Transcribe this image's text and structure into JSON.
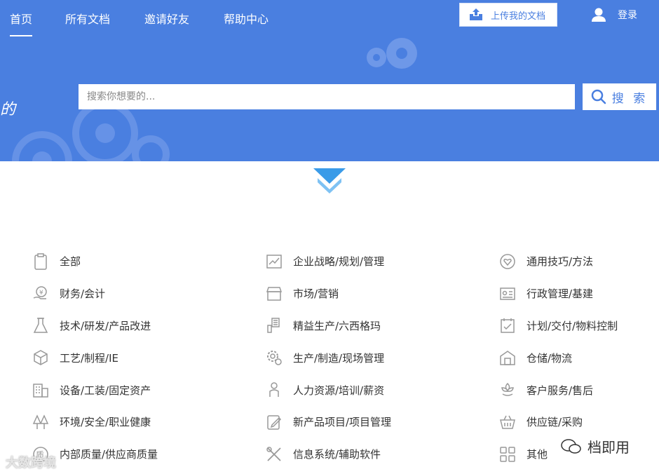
{
  "nav": {
    "items": [
      {
        "label": "首页",
        "active": true
      },
      {
        "label": "所有文档"
      },
      {
        "label": "邀请好友"
      },
      {
        "label": "帮助中心"
      }
    ],
    "upload_label": "上传我的文档",
    "login_label": "登录"
  },
  "search": {
    "placeholder": "搜索你想要的...",
    "button_label": "搜 索"
  },
  "categories": {
    "col1": [
      "全部",
      "财务/会计",
      "技术/研发/产品改进",
      "工艺/制程/IE",
      "设备/工装/固定资产",
      "环境/安全/职业健康",
      "内部质量/供应商质量"
    ],
    "col2": [
      "企业战略/规划/管理",
      "市场/营销",
      "精益生产/六西格玛",
      "生产/制造/现场管理",
      "人力资源/培训/薪资",
      "新产品项目/项目管理",
      "信息系统/辅助软件"
    ],
    "col3": [
      "通用技巧/方法",
      "行政管理/基建",
      "计划/交付/物料控制",
      "仓储/物流",
      "客户服务/售后",
      "供应链/采购",
      "其他"
    ]
  },
  "watermarks": {
    "left": "大数跨境",
    "right": "档即用"
  },
  "colors": {
    "brand": "#4a7fe0",
    "arrow": "#3a9be8"
  }
}
